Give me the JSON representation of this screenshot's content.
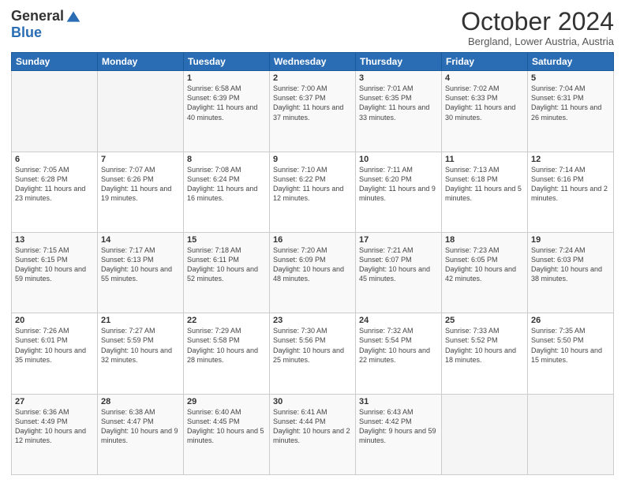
{
  "logo": {
    "general": "General",
    "blue": "Blue"
  },
  "header": {
    "month_title": "October 2024",
    "location": "Bergland, Lower Austria, Austria"
  },
  "weekdays": [
    "Sunday",
    "Monday",
    "Tuesday",
    "Wednesday",
    "Thursday",
    "Friday",
    "Saturday"
  ],
  "weeks": [
    [
      {
        "day": "",
        "sunrise": "",
        "sunset": "",
        "daylight": ""
      },
      {
        "day": "",
        "sunrise": "",
        "sunset": "",
        "daylight": ""
      },
      {
        "day": "1",
        "sunrise": "Sunrise: 6:58 AM",
        "sunset": "Sunset: 6:39 PM",
        "daylight": "Daylight: 11 hours and 40 minutes."
      },
      {
        "day": "2",
        "sunrise": "Sunrise: 7:00 AM",
        "sunset": "Sunset: 6:37 PM",
        "daylight": "Daylight: 11 hours and 37 minutes."
      },
      {
        "day": "3",
        "sunrise": "Sunrise: 7:01 AM",
        "sunset": "Sunset: 6:35 PM",
        "daylight": "Daylight: 11 hours and 33 minutes."
      },
      {
        "day": "4",
        "sunrise": "Sunrise: 7:02 AM",
        "sunset": "Sunset: 6:33 PM",
        "daylight": "Daylight: 11 hours and 30 minutes."
      },
      {
        "day": "5",
        "sunrise": "Sunrise: 7:04 AM",
        "sunset": "Sunset: 6:31 PM",
        "daylight": "Daylight: 11 hours and 26 minutes."
      }
    ],
    [
      {
        "day": "6",
        "sunrise": "Sunrise: 7:05 AM",
        "sunset": "Sunset: 6:28 PM",
        "daylight": "Daylight: 11 hours and 23 minutes."
      },
      {
        "day": "7",
        "sunrise": "Sunrise: 7:07 AM",
        "sunset": "Sunset: 6:26 PM",
        "daylight": "Daylight: 11 hours and 19 minutes."
      },
      {
        "day": "8",
        "sunrise": "Sunrise: 7:08 AM",
        "sunset": "Sunset: 6:24 PM",
        "daylight": "Daylight: 11 hours and 16 minutes."
      },
      {
        "day": "9",
        "sunrise": "Sunrise: 7:10 AM",
        "sunset": "Sunset: 6:22 PM",
        "daylight": "Daylight: 11 hours and 12 minutes."
      },
      {
        "day": "10",
        "sunrise": "Sunrise: 7:11 AM",
        "sunset": "Sunset: 6:20 PM",
        "daylight": "Daylight: 11 hours and 9 minutes."
      },
      {
        "day": "11",
        "sunrise": "Sunrise: 7:13 AM",
        "sunset": "Sunset: 6:18 PM",
        "daylight": "Daylight: 11 hours and 5 minutes."
      },
      {
        "day": "12",
        "sunrise": "Sunrise: 7:14 AM",
        "sunset": "Sunset: 6:16 PM",
        "daylight": "Daylight: 11 hours and 2 minutes."
      }
    ],
    [
      {
        "day": "13",
        "sunrise": "Sunrise: 7:15 AM",
        "sunset": "Sunset: 6:15 PM",
        "daylight": "Daylight: 10 hours and 59 minutes."
      },
      {
        "day": "14",
        "sunrise": "Sunrise: 7:17 AM",
        "sunset": "Sunset: 6:13 PM",
        "daylight": "Daylight: 10 hours and 55 minutes."
      },
      {
        "day": "15",
        "sunrise": "Sunrise: 7:18 AM",
        "sunset": "Sunset: 6:11 PM",
        "daylight": "Daylight: 10 hours and 52 minutes."
      },
      {
        "day": "16",
        "sunrise": "Sunrise: 7:20 AM",
        "sunset": "Sunset: 6:09 PM",
        "daylight": "Daylight: 10 hours and 48 minutes."
      },
      {
        "day": "17",
        "sunrise": "Sunrise: 7:21 AM",
        "sunset": "Sunset: 6:07 PM",
        "daylight": "Daylight: 10 hours and 45 minutes."
      },
      {
        "day": "18",
        "sunrise": "Sunrise: 7:23 AM",
        "sunset": "Sunset: 6:05 PM",
        "daylight": "Daylight: 10 hours and 42 minutes."
      },
      {
        "day": "19",
        "sunrise": "Sunrise: 7:24 AM",
        "sunset": "Sunset: 6:03 PM",
        "daylight": "Daylight: 10 hours and 38 minutes."
      }
    ],
    [
      {
        "day": "20",
        "sunrise": "Sunrise: 7:26 AM",
        "sunset": "Sunset: 6:01 PM",
        "daylight": "Daylight: 10 hours and 35 minutes."
      },
      {
        "day": "21",
        "sunrise": "Sunrise: 7:27 AM",
        "sunset": "Sunset: 5:59 PM",
        "daylight": "Daylight: 10 hours and 32 minutes."
      },
      {
        "day": "22",
        "sunrise": "Sunrise: 7:29 AM",
        "sunset": "Sunset: 5:58 PM",
        "daylight": "Daylight: 10 hours and 28 minutes."
      },
      {
        "day": "23",
        "sunrise": "Sunrise: 7:30 AM",
        "sunset": "Sunset: 5:56 PM",
        "daylight": "Daylight: 10 hours and 25 minutes."
      },
      {
        "day": "24",
        "sunrise": "Sunrise: 7:32 AM",
        "sunset": "Sunset: 5:54 PM",
        "daylight": "Daylight: 10 hours and 22 minutes."
      },
      {
        "day": "25",
        "sunrise": "Sunrise: 7:33 AM",
        "sunset": "Sunset: 5:52 PM",
        "daylight": "Daylight: 10 hours and 18 minutes."
      },
      {
        "day": "26",
        "sunrise": "Sunrise: 7:35 AM",
        "sunset": "Sunset: 5:50 PM",
        "daylight": "Daylight: 10 hours and 15 minutes."
      }
    ],
    [
      {
        "day": "27",
        "sunrise": "Sunrise: 6:36 AM",
        "sunset": "Sunset: 4:49 PM",
        "daylight": "Daylight: 10 hours and 12 minutes."
      },
      {
        "day": "28",
        "sunrise": "Sunrise: 6:38 AM",
        "sunset": "Sunset: 4:47 PM",
        "daylight": "Daylight: 10 hours and 9 minutes."
      },
      {
        "day": "29",
        "sunrise": "Sunrise: 6:40 AM",
        "sunset": "Sunset: 4:45 PM",
        "daylight": "Daylight: 10 hours and 5 minutes."
      },
      {
        "day": "30",
        "sunrise": "Sunrise: 6:41 AM",
        "sunset": "Sunset: 4:44 PM",
        "daylight": "Daylight: 10 hours and 2 minutes."
      },
      {
        "day": "31",
        "sunrise": "Sunrise: 6:43 AM",
        "sunset": "Sunset: 4:42 PM",
        "daylight": "Daylight: 9 hours and 59 minutes."
      },
      {
        "day": "",
        "sunrise": "",
        "sunset": "",
        "daylight": ""
      },
      {
        "day": "",
        "sunrise": "",
        "sunset": "",
        "daylight": ""
      }
    ]
  ]
}
